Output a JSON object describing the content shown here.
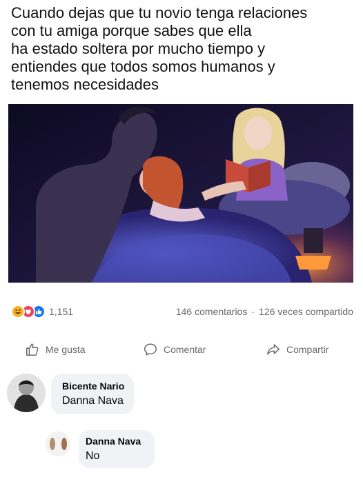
{
  "post": {
    "caption_lines": [
      "Cuando dejas que tu novio tenga relaciones",
      "con tu amiga porque sabes que ella",
      "ha estado soltera por mucho tiempo y",
      "entiendes que todos somos humanos y",
      "tenemos necesidades"
    ],
    "reaction_icons": [
      "haha-icon",
      "love-icon",
      "like-icon"
    ],
    "reaction_count": "1,151",
    "comments_count": "146 comentarios",
    "separator": "·",
    "shares_count": "126 veces compartido"
  },
  "actions": {
    "like_label": "Me gusta",
    "comment_label": "Comentar",
    "share_label": "Compartir"
  },
  "comments": [
    {
      "author": "Bicente Nario",
      "text": "Danna Nava"
    },
    {
      "author": "Danna Nava",
      "text": "No"
    }
  ],
  "colors": {
    "like_blue": "#1877f2",
    "love_red": "#f33e58",
    "haha_yellow": "#f7b125",
    "meta_gray": "#65676b",
    "bubble_bg": "#f0f2f5"
  }
}
